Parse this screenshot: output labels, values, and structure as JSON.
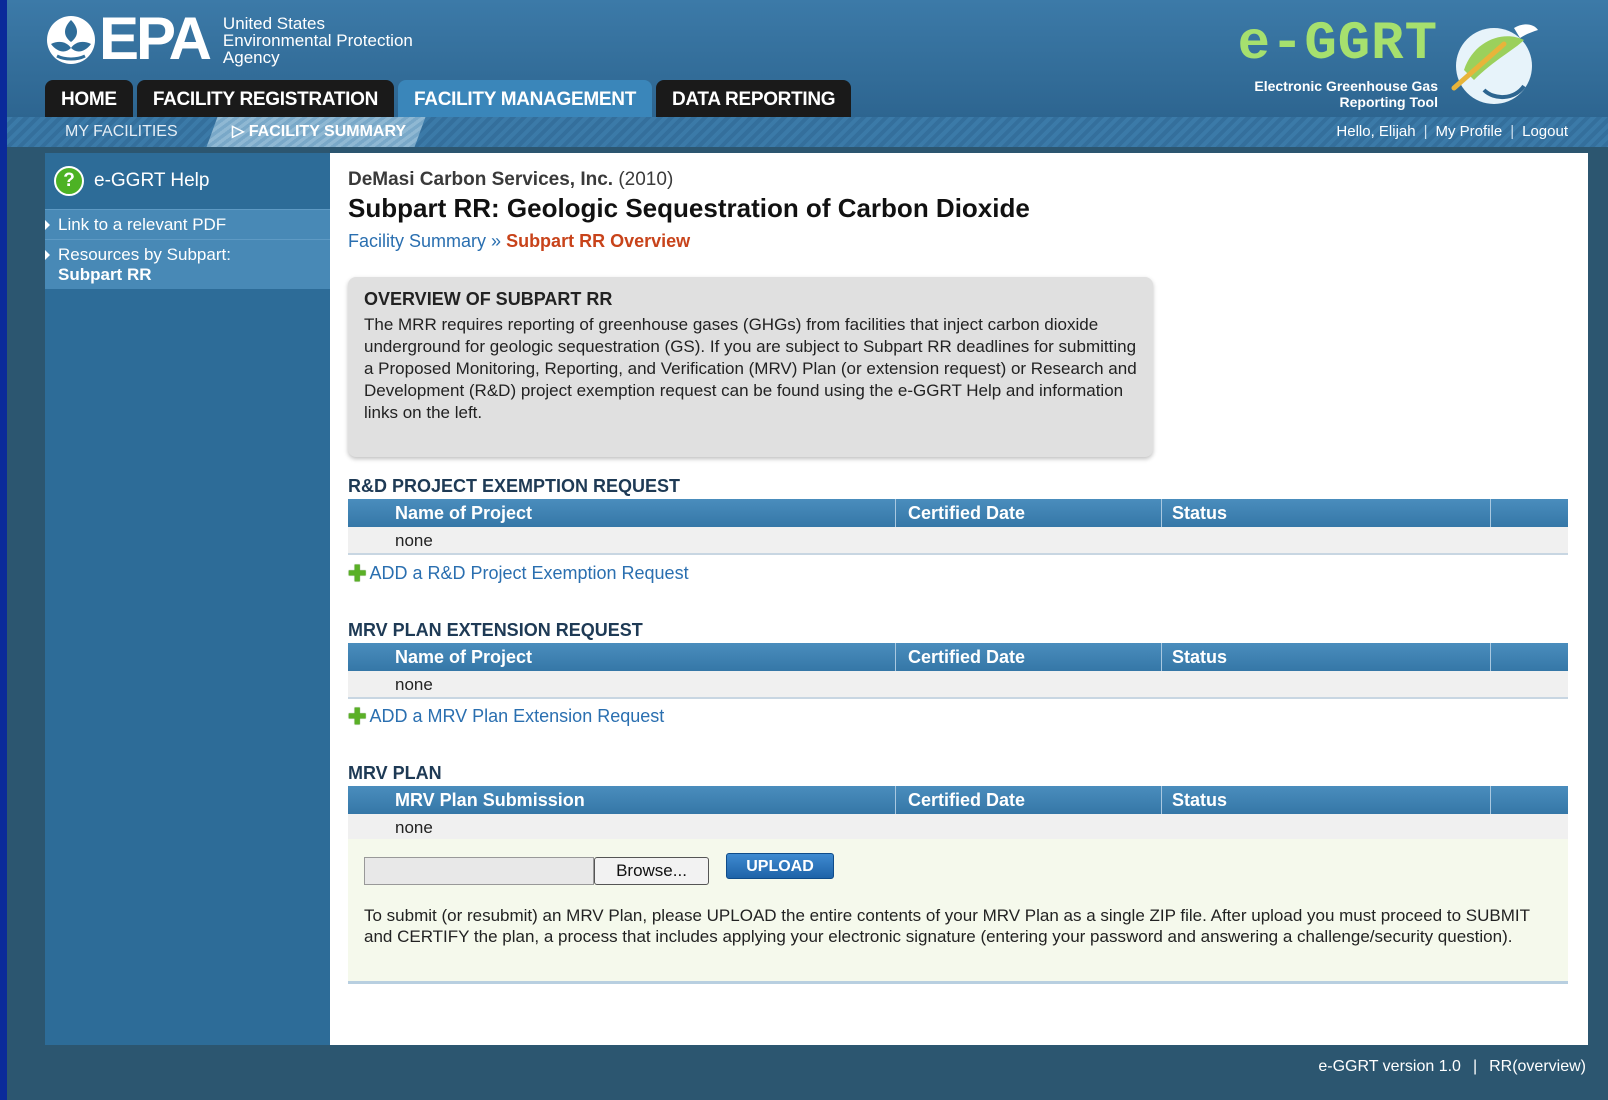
{
  "epa": {
    "logo_text": "EPA",
    "agency_line1": "United States",
    "agency_line2": "Environmental Protection",
    "agency_line3": "Agency"
  },
  "brand": {
    "title": "e-GGRT",
    "subtitle_line1": "Electronic Greenhouse Gas",
    "subtitle_line2": "Reporting Tool",
    "title_color": "#a6e06e"
  },
  "nav": {
    "tabs": [
      {
        "label": "HOME",
        "active": false
      },
      {
        "label": "FACILITY REGISTRATION",
        "active": false
      },
      {
        "label": "FACILITY MANAGEMENT",
        "active": true
      },
      {
        "label": "DATA REPORTING",
        "active": false
      }
    ],
    "subnav": {
      "my_facilities": "MY FACILITIES",
      "facility_summary": "FACILITY SUMMARY"
    },
    "user": {
      "greeting": "Hello, Elijah",
      "profile": "My Profile",
      "logout": "Logout",
      "separator": "|"
    }
  },
  "sidebar": {
    "help": "e-GGRT Help",
    "help_icon": "?",
    "links": {
      "pdf": "Link to a relevant PDF",
      "resources": "Resources by Subpart:",
      "resources_subpart": "Subpart RR"
    }
  },
  "page": {
    "company": "DeMasi Carbon Services, Inc.",
    "year": "(2010)",
    "title": "Subpart RR: Geologic Sequestration of Carbon Dioxide",
    "breadcrumb_link": "Facility Summary",
    "breadcrumb_sep": "»",
    "breadcrumb_current": "Subpart RR Overview"
  },
  "overview": {
    "title": "OVERVIEW OF SUBPART RR",
    "body": "The MRR requires reporting of greenhouse gases (GHGs) from facilities that inject carbon dioxide underground for geologic sequestration (GS). If you are subject to Subpart RR deadlines for submitting a Proposed Monitoring, Reporting, and Verification (MRV) Plan (or extension request) or Research and Development (R&D) project exemption request can be found using the e-GGRT Help and information links on the left."
  },
  "sections": {
    "rd": {
      "title": "R&D PROJECT EXEMPTION REQUEST",
      "col1": "Name of Project",
      "col2": "Certified Date",
      "col3": "Status",
      "row": "none",
      "add": "ADD a R&D Project Exemption Request"
    },
    "mrv_ext": {
      "title": "MRV PLAN EXTENSION REQUEST",
      "col1": "Name of Project",
      "col2": "Certified Date",
      "col3": "Status",
      "row": "none",
      "add": "ADD a MRV Plan Extension Request"
    },
    "mrv": {
      "title": "MRV PLAN",
      "col1": "MRV Plan Submission",
      "col2": "Certified Date",
      "col3": "Status",
      "row": "none"
    }
  },
  "upload": {
    "file_value": "",
    "browse": "Browse...",
    "upload": "UPLOAD",
    "note": "To submit (or resubmit) an MRV Plan, please UPLOAD the entire contents of your MRV Plan as a single ZIP file. After upload you must proceed to SUBMIT and CERTIFY the plan, a process that includes applying your electronic signature (entering your password and answering a challenge/security question)."
  },
  "footer": {
    "version": "e-GGRT version 1.0",
    "separator": "|",
    "page_id": "RR(overview)"
  },
  "icons": {
    "help": "help-circle-icon",
    "add": "plus-icon",
    "nav_arrow": "play-arrow-icon"
  }
}
